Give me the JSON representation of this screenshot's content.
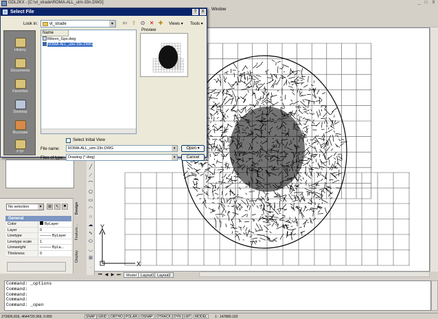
{
  "app": {
    "title": "GDL2KX - [C:\\vt_strade\\ROMA-ALL_utm-33n.DWG]",
    "menu_window": "Window",
    "win_controls": [
      "_",
      "□",
      "X"
    ]
  },
  "dialog": {
    "title": "Select File",
    "title_controls": [
      "?",
      "X"
    ],
    "look_in_label": "Look in:",
    "look_in_value": "vt_strade",
    "views_label": "Views",
    "tools_label": "Tools",
    "places": [
      "History",
      "Documents",
      "Favorites",
      "Desktop",
      "Buzzsaw",
      "FTP"
    ],
    "list_header": "Name",
    "files": [
      {
        "name": "Rilievo_Gps.dwg",
        "selected": false
      },
      {
        "name": "ROMA-ALL_utm-33n.DWG",
        "selected": true
      }
    ],
    "preview_label": "Preview",
    "select_initial_view": "Select Initial View",
    "file_name_label": "File name:",
    "file_name_value": "ROMA-ALL_utm-33n.DWG",
    "files_of_type_label": "Files of type:",
    "files_of_type_value": "Drawing (*.dwg)",
    "open_button": "Open",
    "cancel_button": "Cancel"
  },
  "properties": {
    "selection": "No selection",
    "section": "General",
    "rows": [
      {
        "key": "Color",
        "value": "ByLayer"
      },
      {
        "key": "Layer",
        "value": "0"
      },
      {
        "key": "Linetype",
        "value": "——— ByLayer"
      },
      {
        "key": "Linetype scale",
        "value": "1"
      },
      {
        "key": "Lineweight",
        "value": "——— ByLa..."
      },
      {
        "key": "Thickness",
        "value": "0"
      }
    ],
    "side_tabs": [
      "Design",
      "Feature...",
      "Display"
    ]
  },
  "canvas": {
    "ucs_x": "X",
    "ucs_y": "Y",
    "tabs": [
      "Model",
      "Layout1",
      "Layout2"
    ],
    "active_tab": "Model"
  },
  "command_line": [
    "Command: _options",
    "Command:",
    "Command:",
    "Command:",
    "Command: _open"
  ],
  "status": {
    "coords": "272826.816, 4644720.369, 0.000",
    "toggles": [
      "SNAP",
      "GRID",
      "ORTHO",
      "POLAR",
      "OSNAP",
      "OTRACK",
      "DYN",
      "LWT",
      "MODEL"
    ],
    "scale": "1 : 147880.102"
  },
  "colors": {
    "dialog_title_bg": "#0a246a",
    "selection_blue": "#316ac5",
    "props_header": "#7d96c2"
  }
}
